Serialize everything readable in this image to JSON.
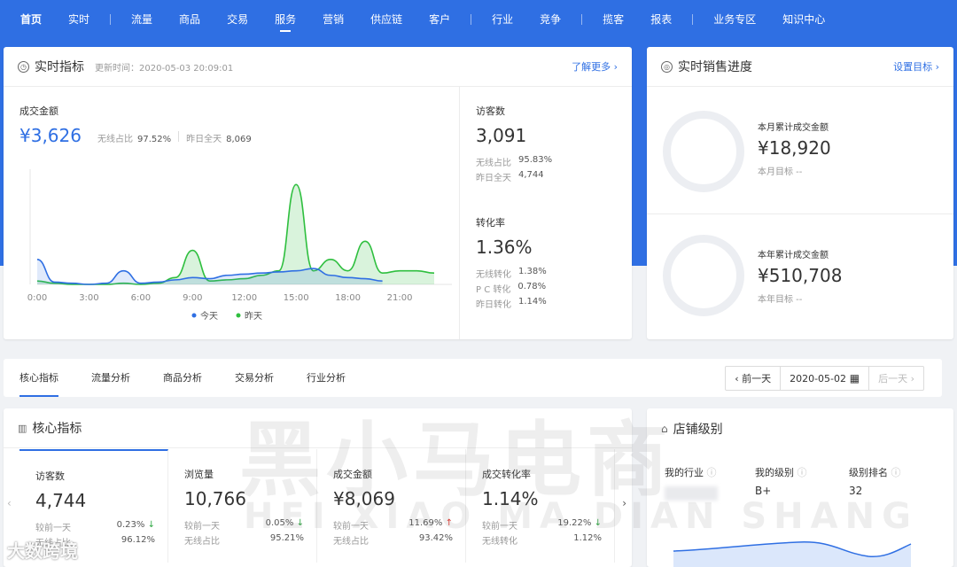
{
  "nav": [
    {
      "label": "首页",
      "bold": true
    },
    {
      "label": "实时"
    },
    {
      "sep": true
    },
    {
      "label": "流量"
    },
    {
      "label": "商品"
    },
    {
      "label": "交易"
    },
    {
      "label": "服务",
      "active": true
    },
    {
      "label": "营销"
    },
    {
      "label": "供应链"
    },
    {
      "label": "客户"
    },
    {
      "sep": true
    },
    {
      "label": "行业"
    },
    {
      "label": "竞争"
    },
    {
      "sep": true
    },
    {
      "label": "揽客"
    },
    {
      "label": "报表"
    },
    {
      "sep": true
    },
    {
      "label": "业务专区"
    },
    {
      "label": "知识中心"
    }
  ],
  "realtime": {
    "title": "实时指标",
    "updated": "更新时间：2020-05-03 20:09:01",
    "more": "了解更多 ›",
    "gmv_label": "成交金额",
    "gmv_value": "¥3,626",
    "wireless_label": "无线占比",
    "wireless_value": "97.52%",
    "yesterday_label": "昨日全天",
    "yesterday_value": "8,069",
    "visitors_label": "访客数",
    "visitors_value": "3,091",
    "v_wireless_label": "无线占比",
    "v_wireless_value": "95.83%",
    "v_yesterday_label": "昨日全天",
    "v_yesterday_value": "4,744",
    "conv_label": "转化率",
    "conv_value": "1.36%",
    "c_wireless_label": "无线转化",
    "c_wireless_value": "1.38%",
    "c_pc_label": "P C 转化",
    "c_pc_value": "0.78%",
    "c_yesterday_label": "昨日转化",
    "c_yesterday_value": "1.14%"
  },
  "chart_data": {
    "type": "area",
    "x_ticks": [
      "0:00",
      "3:00",
      "6:00",
      "9:00",
      "12:00",
      "15:00",
      "18:00",
      "21:00"
    ],
    "x": [
      0,
      1,
      2,
      3,
      4,
      5,
      6,
      7,
      8,
      9,
      10,
      11,
      12,
      13,
      14,
      15,
      16,
      17,
      18,
      19,
      20,
      21,
      22,
      23
    ],
    "series": [
      {
        "name": "今天",
        "color": "#2f6fe3",
        "values": [
          22,
          2,
          1,
          0,
          1,
          12,
          1,
          2,
          4,
          6,
          5,
          8,
          9,
          10,
          11,
          12,
          14,
          8,
          6,
          5,
          3,
          null,
          null,
          null
        ]
      },
      {
        "name": "昨天",
        "color": "#2fbf3f",
        "values": [
          3,
          1,
          0,
          0,
          0,
          1,
          0,
          1,
          6,
          30,
          3,
          4,
          5,
          8,
          12,
          88,
          12,
          22,
          12,
          38,
          10,
          12,
          12,
          10
        ]
      }
    ],
    "ylim": [
      0,
      100
    ],
    "grid": false,
    "legend": "bottom"
  },
  "sales": {
    "title": "实时销售进度",
    "set_target": "设置目标 ›",
    "month_label": "本月累计成交金额",
    "month_value": "¥18,920",
    "month_target": "本月目标 --",
    "year_label": "本年累计成交金额",
    "year_value": "¥510,708",
    "year_target": "本年目标 --"
  },
  "tabs": [
    "核心指标",
    "流量分析",
    "商品分析",
    "交易分析",
    "行业分析"
  ],
  "date": {
    "prev": "‹ 前一天",
    "value": "2020-05-02",
    "next": "后一天 ›"
  },
  "core": {
    "title": "核心指标",
    "kpis": [
      {
        "label": "访客数",
        "value": "4,744",
        "cmp_label": "较前一天",
        "cmp_value": "0.23%",
        "dir": "down",
        "share_label": "无线占比",
        "share_value": "96.12%"
      },
      {
        "label": "浏览量",
        "value": "10,766",
        "cmp_label": "较前一天",
        "cmp_value": "0.05%",
        "dir": "down",
        "share_label": "无线占比",
        "share_value": "95.21%"
      },
      {
        "label": "成交金额",
        "value": "¥8,069",
        "cmp_label": "较前一天",
        "cmp_value": "11.69%",
        "dir": "up",
        "share_label": "无线占比",
        "share_value": "93.42%"
      },
      {
        "label": "成交转化率",
        "value": "1.14%",
        "cmp_label": "较前一天",
        "cmp_value": "19.22%",
        "dir": "down",
        "share_label": "无线转化",
        "share_value": "1.12%"
      }
    ]
  },
  "shop": {
    "title": "店铺级别",
    "industry_label": "我的行业",
    "level_label": "我的级别",
    "level_value": "B+",
    "rank_label": "级别排名",
    "rank_value": "32"
  },
  "watermark": {
    "cn": "黑小马电商",
    "pinyin": "HEI XIAO MA DIAN SHANG",
    "logo": "大数跨境"
  }
}
